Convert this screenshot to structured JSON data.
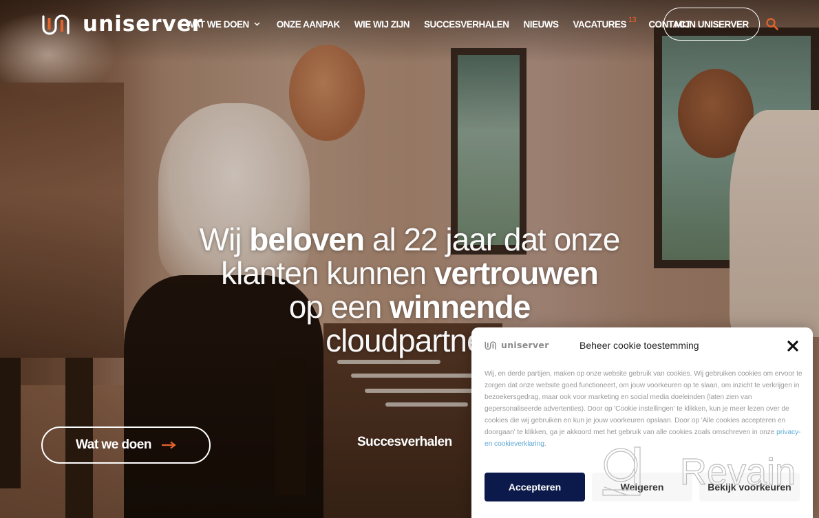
{
  "brand": {
    "name": "uniserver",
    "accent_color": "#e4642c",
    "dark_navy": "#0c1a4b"
  },
  "header": {
    "logo_icon": "uniserver-logo-mark",
    "nav": [
      {
        "label": "WAT WE DOEN",
        "has_dropdown": true,
        "icon": "chevron-down-icon"
      },
      {
        "label": "ONZE AANPAK"
      },
      {
        "label": "WIE WIJ ZIJN"
      },
      {
        "label": "SUCCESVERHALEN"
      },
      {
        "label": "NIEUWS"
      },
      {
        "label": "VACATURES",
        "badge": "13"
      },
      {
        "label": "CONTACT"
      }
    ],
    "account_button": "MIJN UNISERVER",
    "search_icon": "search-icon"
  },
  "hero": {
    "headline": {
      "line1": [
        {
          "text": "Wij ",
          "bold": false
        },
        {
          "text": "beloven",
          "bold": true
        },
        {
          "text": " al 22 jaar dat onze",
          "bold": false
        }
      ],
      "line2": [
        {
          "text": "klanten kunnen ",
          "bold": false
        },
        {
          "text": "vertrouwen",
          "bold": true
        }
      ],
      "line3": [
        {
          "text": "op een ",
          "bold": false
        },
        {
          "text": "winnende",
          "bold": true
        }
      ],
      "line4": [
        {
          "text": "cloudpartner",
          "bold": false
        }
      ]
    },
    "primary_cta": "Wat we doen",
    "primary_cta_icon": "arrow-right-icon",
    "secondary_cta": "Succesverhalen"
  },
  "cookie_dialog": {
    "brand": "uniserver",
    "title": "Beheer cookie toestemming",
    "close_icon": "close-icon",
    "body": "Wij, en derde partijen, maken op onze website gebruik van cookies. Wij gebruiken cookies om ervoor te zorgen dat onze website goed functioneert, om jouw voorkeuren op te slaan, om inzicht te verkrijgen in bezoekersgedrag, maar ook voor marketing en social media doeleinden (laten zien van gepersonaliseerde advertenties). Door op 'Cookie instellingen' te klikken, kun je meer lezen over de cookies die wij gebruiken en kun je jouw voorkeuren opslaan. Door op 'Alle cookies accepteren en doorgaan' te klikken, ga je akkoord met het gebruik van alle cookies zoals omschreven in onze ",
    "link_text": "privacy- en cookieverklaring",
    "body_end": ".",
    "buttons": {
      "accept": "Accepteren",
      "deny": "Weigeren",
      "preferences": "Bekijk voorkeuren"
    }
  },
  "watermark": {
    "text": "Revain"
  }
}
